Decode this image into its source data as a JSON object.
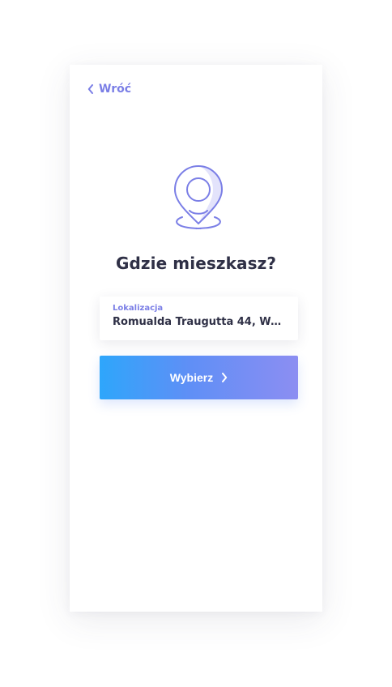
{
  "header": {
    "back_label": "Wróć"
  },
  "main": {
    "title": "Gdzie mieszkasz?",
    "location_field": {
      "label": "Lokalizacja",
      "value": "Romualda Traugutta 44, Warsz..."
    },
    "submit_label": "Wybierz"
  },
  "icons": {
    "back": "chevron-left-icon",
    "pin": "location-pin-icon",
    "submit": "chevron-right-icon"
  },
  "colors": {
    "accent": "#7b7fe6",
    "text_dark": "#2f3046",
    "button_gradient_start": "#2ea6fb",
    "button_gradient_end": "#8c8ef2"
  }
}
